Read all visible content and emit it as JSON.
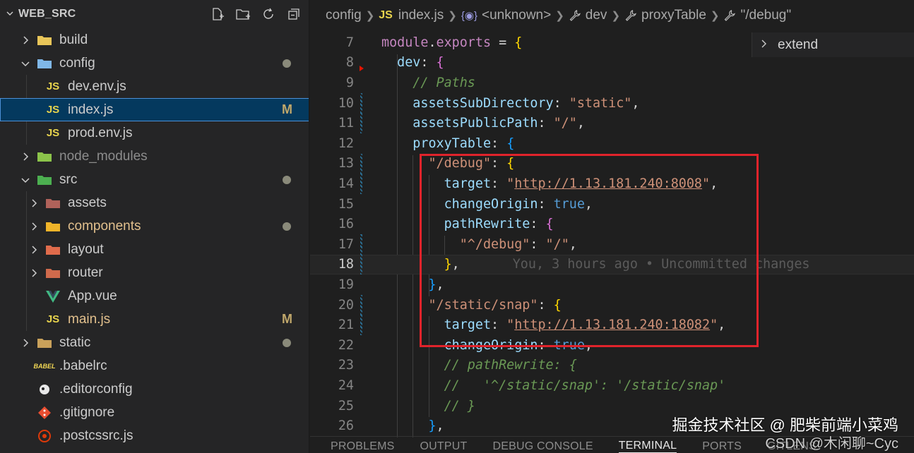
{
  "explorer": {
    "root_label": "WEB_SRC",
    "actions": [
      "new-file-icon",
      "new-folder-icon",
      "refresh-icon",
      "collapse-all-icon"
    ],
    "items": [
      {
        "label": "build",
        "kind": "folder",
        "icon": "folder-build-icon",
        "expanded": false,
        "depth": 0
      },
      {
        "label": "config",
        "kind": "folder",
        "icon": "folder-config-icon",
        "expanded": true,
        "depth": 0,
        "status": "dot"
      },
      {
        "label": "dev.env.js",
        "kind": "js",
        "icon": "JS",
        "depth": 1
      },
      {
        "label": "index.js",
        "kind": "js",
        "icon": "JS",
        "depth": 1,
        "selected": true,
        "badge": "M"
      },
      {
        "label": "prod.env.js",
        "kind": "js",
        "icon": "JS",
        "depth": 1
      },
      {
        "label": "node_modules",
        "kind": "folder",
        "icon": "folder-node-icon",
        "expanded": false,
        "depth": 0,
        "dim": true
      },
      {
        "label": "src",
        "kind": "folder",
        "icon": "folder-src-icon",
        "expanded": true,
        "depth": 0,
        "status": "dot"
      },
      {
        "label": "assets",
        "kind": "folder",
        "icon": "folder-assets-icon",
        "expanded": false,
        "depth": 1
      },
      {
        "label": "components",
        "kind": "folder",
        "icon": "folder-components-icon",
        "expanded": false,
        "depth": 1,
        "status": "dot",
        "color": "#e2c08d"
      },
      {
        "label": "layout",
        "kind": "folder",
        "icon": "folder-layout-icon",
        "expanded": false,
        "depth": 1
      },
      {
        "label": "router",
        "kind": "folder",
        "icon": "folder-router-icon",
        "expanded": false,
        "depth": 1
      },
      {
        "label": "App.vue",
        "kind": "vue",
        "icon": "vue-icon",
        "depth": 1
      },
      {
        "label": "main.js",
        "kind": "js",
        "icon": "JS",
        "depth": 1,
        "badge": "M",
        "color": "#e2c08d"
      },
      {
        "label": "static",
        "kind": "folder",
        "icon": "folder-static-icon",
        "expanded": false,
        "depth": 0,
        "status": "dot"
      },
      {
        "label": ".babelrc",
        "kind": "file",
        "icon": "babel-icon",
        "depth": 0
      },
      {
        "label": ".editorconfig",
        "kind": "file",
        "icon": "editorconfig-icon",
        "depth": 0
      },
      {
        "label": ".gitignore",
        "kind": "file",
        "icon": "git-icon",
        "depth": 0
      },
      {
        "label": ".postcssrc.js",
        "kind": "file",
        "icon": "postcss-icon",
        "depth": 0
      }
    ]
  },
  "breadcrumb": {
    "items": [
      {
        "label": "config",
        "icon": ""
      },
      {
        "label": "index.js",
        "icon": "JS"
      },
      {
        "label": "<unknown>",
        "icon": "{◉}"
      },
      {
        "label": "dev",
        "icon": "wrench-icon"
      },
      {
        "label": "proxyTable",
        "icon": "wrench-icon"
      },
      {
        "label": "\"/debug\"",
        "icon": "wrench-icon"
      }
    ]
  },
  "suggest_widget": {
    "label": "extend"
  },
  "code": {
    "current_line": 18,
    "blame_text": "You, 3 hours ago • Uncommitted changes",
    "lines": [
      {
        "n": "7",
        "text": "module.exports = {"
      },
      {
        "n": "8",
        "text": "  dev: {"
      },
      {
        "n": "9",
        "text": "    // Paths"
      },
      {
        "n": "10",
        "text": "    assetsSubDirectory: \"static\","
      },
      {
        "n": "11",
        "text": "    assetsPublicPath: \"/\","
      },
      {
        "n": "12",
        "text": "    proxyTable: {"
      },
      {
        "n": "13",
        "text": "      \"/debug\": {"
      },
      {
        "n": "14",
        "text": "        target: \"http://1.13.181.240:8008\","
      },
      {
        "n": "15",
        "text": "        changeOrigin: true,"
      },
      {
        "n": "16",
        "text": "        pathRewrite: {"
      },
      {
        "n": "17",
        "text": "          \"^/debug\": \"/\","
      },
      {
        "n": "18",
        "text": "        },"
      },
      {
        "n": "19",
        "text": "      },"
      },
      {
        "n": "20",
        "text": "      \"/static/snap\": {"
      },
      {
        "n": "21",
        "text": "        target: \"http://1.13.181.240:18082\","
      },
      {
        "n": "22",
        "text": "        changeOrigin: true,"
      },
      {
        "n": "23",
        "text": "        // pathRewrite: {"
      },
      {
        "n": "24",
        "text": "        //   '^/static/snap': '/static/snap'"
      },
      {
        "n": "25",
        "text": "        // }"
      },
      {
        "n": "26",
        "text": "      },"
      }
    ]
  },
  "panel": {
    "tabs": [
      "PROBLEMS",
      "OUTPUT",
      "DEBUG CONSOLE",
      "TERMINAL",
      "PORTS",
      "GITLENS"
    ],
    "active_tab": "TERMINAL"
  },
  "watermark": {
    "line1": "掘金技术社区 @ 肥柴前端小菜鸡",
    "line2": "CSDN @木闲聊~Cyc"
  },
  "colors": {
    "sidebar_bg": "#252526",
    "editor_bg": "#1f1f1f",
    "selection": "#04395e",
    "highlight_box": "#e0232b",
    "modified": "#e2c08d"
  }
}
